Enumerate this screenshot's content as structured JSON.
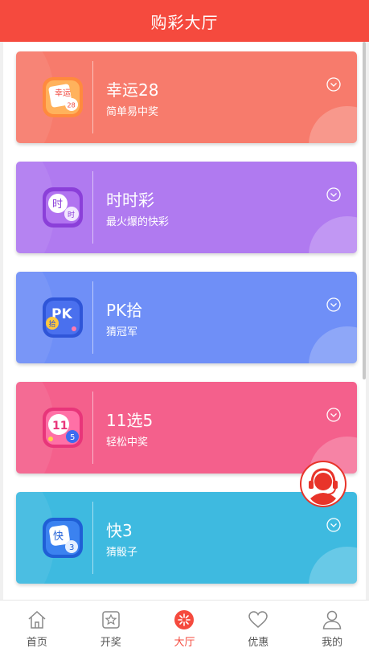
{
  "header": {
    "title": "购彩大厅"
  },
  "games": [
    {
      "name": "幸运28",
      "subtitle": "简单易中奖",
      "icon": "lucky28-icon",
      "color": "#f77b6c",
      "icon_text": "幸运"
    },
    {
      "name": "时时彩",
      "subtitle": "最火爆的快彩",
      "icon": "ssc-icon",
      "color": "#b07af0",
      "icon_text": "时"
    },
    {
      "name": "PK拾",
      "subtitle": "猜冠军",
      "icon": "pk10-icon",
      "color": "#6f8ff7",
      "icon_text": "PK"
    },
    {
      "name": "11选5",
      "subtitle": "轻松中奖",
      "icon": "11x5-icon",
      "color": "#f4608c",
      "icon_text": "11"
    },
    {
      "name": "快3",
      "subtitle": "猜骰子",
      "icon": "k3-icon",
      "color": "#3ebae0",
      "icon_text": "快"
    }
  ],
  "tabbar": {
    "tabs": [
      {
        "label": "首页",
        "icon": "home-icon"
      },
      {
        "label": "开奖",
        "icon": "star-icon"
      },
      {
        "label": "大厅",
        "icon": "hall-icon",
        "active": true
      },
      {
        "label": "优惠",
        "icon": "heart-icon"
      },
      {
        "label": "我的",
        "icon": "user-icon"
      }
    ],
    "active_color": "#f54a3e"
  },
  "support": {
    "icon": "customer-service-icon"
  }
}
